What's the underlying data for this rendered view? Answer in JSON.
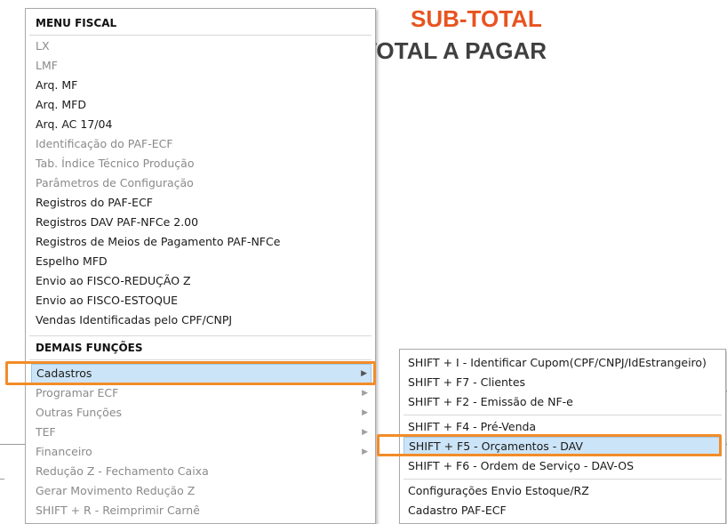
{
  "background": {
    "subtotal_label": "SUB-TOTAL",
    "total_label": "TOTAL A PAGAR",
    "subtotal_color": "#e8531f"
  },
  "main_menu": {
    "header_fiscal": "MENU FISCAL",
    "fiscal_items": [
      {
        "label": "LX",
        "enabled": false
      },
      {
        "label": "LMF",
        "enabled": false
      },
      {
        "label": "Arq. MF",
        "enabled": true
      },
      {
        "label": "Arq. MFD",
        "enabled": true
      },
      {
        "label": "Arq. AC 17/04",
        "enabled": true
      },
      {
        "label": "Identificação do PAF-ECF",
        "enabled": false
      },
      {
        "label": "Tab. Índice Técnico Produção",
        "enabled": false
      },
      {
        "label": "Parâmetros de Configuração",
        "enabled": false
      },
      {
        "label": "Registros do PAF-ECF",
        "enabled": true
      },
      {
        "label": "Registros DAV PAF-NFCe 2.00",
        "enabled": true
      },
      {
        "label": "Registros de Meios de Pagamento PAF-NFCe",
        "enabled": true
      },
      {
        "label": "Espelho MFD",
        "enabled": true
      },
      {
        "label": "Envio ao FISCO-REDUÇÃO Z",
        "enabled": true
      },
      {
        "label": "Envio ao FISCO-ESTOQUE",
        "enabled": true
      },
      {
        "label": "Vendas Identificadas pelo CPF/CNPJ",
        "enabled": true
      }
    ],
    "header_demais": "DEMAIS FUNÇÕES",
    "demais_items": [
      {
        "label": "Cadastros",
        "enabled": true,
        "submenu": true,
        "selected": true
      },
      {
        "label": "Programar ECF",
        "enabled": false,
        "submenu": true
      },
      {
        "label": "Outras Funções",
        "enabled": false,
        "submenu": true
      },
      {
        "label": "TEF",
        "enabled": false,
        "submenu": true
      },
      {
        "label": "Financeiro",
        "enabled": false,
        "submenu": true
      },
      {
        "label": "Redução Z - Fechamento Caixa",
        "enabled": false
      },
      {
        "label": "Gerar Movimento Redução Z",
        "enabled": false
      },
      {
        "label": "SHIFT + R - Reimprimir Carnê",
        "enabled": false
      }
    ],
    "submenu_arrow": "▶"
  },
  "cadastros_submenu": {
    "group1": [
      "SHIFT + I - Identificar Cupom(CPF/CNPJ/IdEstrangeiro)",
      "SHIFT + F7 - Clientes",
      "SHIFT + F2 - Emissão de NF-e"
    ],
    "group2": [
      "SHIFT + F4 - Pré-Venda",
      "SHIFT + F5 - Orçamentos - DAV",
      "SHIFT + F6 - Ordem de Serviço - DAV-OS"
    ],
    "group3": [
      "Configurações Envio Estoque/RZ",
      "Cadastro PAF-ECF"
    ],
    "selected_label": "SHIFT + F5 - Orçamentos - DAV"
  },
  "colors": {
    "highlight_border": "#f28c28",
    "selection_fill": "#cce4f7",
    "disabled_text": "#8a8a8a"
  }
}
